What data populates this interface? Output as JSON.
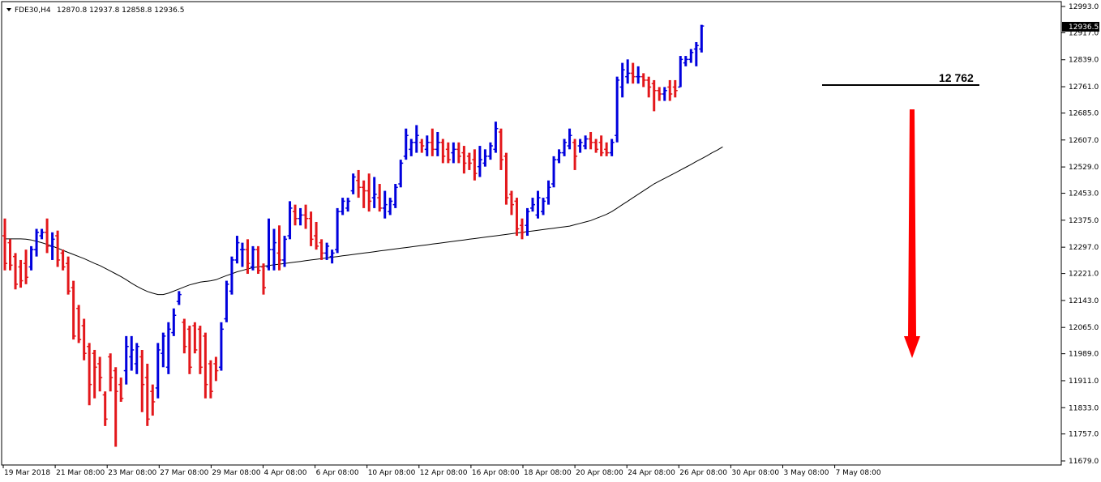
{
  "header": {
    "symbol": "FDE30,H4",
    "ohlc": "12870.8 12937.8 12858.8 12936.5"
  },
  "current_price_label": "12936.5",
  "level_label": "12 762",
  "colors": {
    "up": "#0000dd",
    "down": "#e3171b",
    "ma": "#000000",
    "arrow": "#ff0000",
    "price_box": "#000000"
  },
  "chart_data": {
    "type": "ohlc",
    "y_ticks": [
      "12993.0",
      "12917.0",
      "12839.0",
      "12761.0",
      "12685.0",
      "12607.0",
      "12529.0",
      "12453.0",
      "12375.0",
      "12297.0",
      "12221.0",
      "12143.0",
      "12065.0",
      "11989.0",
      "11911.0",
      "11833.0",
      "11757.0",
      "11679.0"
    ],
    "ylim": [
      11679,
      12993
    ],
    "x_ticks": [
      "19 Mar 2018",
      "21 Mar 08:00",
      "23 Mar 08:00",
      "27 Mar 08:00",
      "29 Mar 08:00",
      "4 Apr 08:00",
      "6 Apr 08:00",
      "10 Apr 08:00",
      "12 Apr 08:00",
      "16 Apr 08:00",
      "18 Apr 08:00",
      "20 Apr 08:00",
      "24 Apr 08:00",
      "26 Apr 08:00",
      "30 Apr 08:00",
      "3 May 08:00",
      "7 May 08:00"
    ],
    "bars": [
      {
        "o": 12330,
        "h": 12380,
        "l": 12230,
        "c": 12250
      },
      {
        "o": 12310,
        "h": 12320,
        "l": 12230,
        "c": 12245
      },
      {
        "o": 12270,
        "h": 12280,
        "l": 12175,
        "c": 12190
      },
      {
        "o": 12240,
        "h": 12260,
        "l": 12180,
        "c": 12200
      },
      {
        "o": 12250,
        "h": 12290,
        "l": 12190,
        "c": 12210
      },
      {
        "o": 12240,
        "h": 12300,
        "l": 12230,
        "c": 12290
      },
      {
        "o": 12290,
        "h": 12350,
        "l": 12270,
        "c": 12340
      },
      {
        "o": 12330,
        "h": 12350,
        "l": 12320,
        "c": 12340
      },
      {
        "o": 12340,
        "h": 12380,
        "l": 12280,
        "c": 12300
      },
      {
        "o": 12300,
        "h": 12340,
        "l": 12260,
        "c": 12320
      },
      {
        "o": 12330,
        "h": 12345,
        "l": 12240,
        "c": 12260
      },
      {
        "o": 12280,
        "h": 12290,
        "l": 12230,
        "c": 12240
      },
      {
        "o": 12250,
        "h": 12270,
        "l": 12160,
        "c": 12170
      },
      {
        "o": 12180,
        "h": 12200,
        "l": 12030,
        "c": 12040
      },
      {
        "o": 12120,
        "h": 12130,
        "l": 12020,
        "c": 12030
      },
      {
        "o": 12070,
        "h": 12090,
        "l": 11970,
        "c": 11990
      },
      {
        "o": 12010,
        "h": 12020,
        "l": 11840,
        "c": 11900
      },
      {
        "o": 11990,
        "h": 12000,
        "l": 11860,
        "c": 11950
      },
      {
        "o": 11960,
        "h": 11980,
        "l": 11880,
        "c": 11920
      },
      {
        "o": 11870,
        "h": 11880,
        "l": 11780,
        "c": 11800
      },
      {
        "o": 11980,
        "h": 11990,
        "l": 11880,
        "c": 11920
      },
      {
        "o": 11940,
        "h": 11950,
        "l": 11720,
        "c": 11880
      },
      {
        "o": 11900,
        "h": 11920,
        "l": 11850,
        "c": 11860
      },
      {
        "o": 11940,
        "h": 12040,
        "l": 11900,
        "c": 12010
      },
      {
        "o": 11980,
        "h": 12040,
        "l": 11940,
        "c": 12000
      },
      {
        "o": 11960,
        "h": 12020,
        "l": 11930,
        "c": 12010
      },
      {
        "o": 11980,
        "h": 12000,
        "l": 11820,
        "c": 11900
      },
      {
        "o": 11920,
        "h": 11960,
        "l": 11780,
        "c": 11800
      },
      {
        "o": 11880,
        "h": 11900,
        "l": 11810,
        "c": 11850
      },
      {
        "o": 11890,
        "h": 12020,
        "l": 11860,
        "c": 12000
      },
      {
        "o": 11990,
        "h": 12050,
        "l": 11950,
        "c": 12040
      },
      {
        "o": 11950,
        "h": 12080,
        "l": 11930,
        "c": 12060
      },
      {
        "o": 12050,
        "h": 12120,
        "l": 12040,
        "c": 12100
      },
      {
        "o": 12140,
        "h": 12170,
        "l": 12130,
        "c": 12160
      },
      {
        "o": 12080,
        "h": 12090,
        "l": 11990,
        "c": 12010
      },
      {
        "o": 12060,
        "h": 12070,
        "l": 11930,
        "c": 11950
      },
      {
        "o": 12070,
        "h": 12080,
        "l": 11990,
        "c": 12000
      },
      {
        "o": 12060,
        "h": 12070,
        "l": 11930,
        "c": 11950
      },
      {
        "o": 12040,
        "h": 12050,
        "l": 11860,
        "c": 11900
      },
      {
        "o": 11960,
        "h": 11970,
        "l": 11860,
        "c": 11880
      },
      {
        "o": 11960,
        "h": 11980,
        "l": 11910,
        "c": 11940
      },
      {
        "o": 11950,
        "h": 12080,
        "l": 11940,
        "c": 12060
      },
      {
        "o": 12090,
        "h": 12200,
        "l": 12080,
        "c": 12190
      },
      {
        "o": 12170,
        "h": 12270,
        "l": 12160,
        "c": 12260
      },
      {
        "o": 12260,
        "h": 12330,
        "l": 12250,
        "c": 12310
      },
      {
        "o": 12290,
        "h": 12310,
        "l": 12240,
        "c": 12290
      },
      {
        "o": 12290,
        "h": 12320,
        "l": 12220,
        "c": 12250
      },
      {
        "o": 12240,
        "h": 12300,
        "l": 12230,
        "c": 12290
      },
      {
        "o": 12290,
        "h": 12300,
        "l": 12220,
        "c": 12230
      },
      {
        "o": 12240,
        "h": 12250,
        "l": 12160,
        "c": 12180
      },
      {
        "o": 12240,
        "h": 12380,
        "l": 12230,
        "c": 12290
      },
      {
        "o": 12290,
        "h": 12350,
        "l": 12230,
        "c": 12310
      },
      {
        "o": 12280,
        "h": 12360,
        "l": 12230,
        "c": 12260
      },
      {
        "o": 12260,
        "h": 12330,
        "l": 12240,
        "c": 12320
      },
      {
        "o": 12330,
        "h": 12430,
        "l": 12320,
        "c": 12410
      },
      {
        "o": 12400,
        "h": 12420,
        "l": 12360,
        "c": 12380
      },
      {
        "o": 12380,
        "h": 12410,
        "l": 12360,
        "c": 12390
      },
      {
        "o": 12390,
        "h": 12420,
        "l": 12350,
        "c": 12380
      },
      {
        "o": 12380,
        "h": 12400,
        "l": 12300,
        "c": 12320
      },
      {
        "o": 12330,
        "h": 12370,
        "l": 12290,
        "c": 12300
      },
      {
        "o": 12310,
        "h": 12320,
        "l": 12260,
        "c": 12280
      },
      {
        "o": 12280,
        "h": 12310,
        "l": 12260,
        "c": 12300
      },
      {
        "o": 12270,
        "h": 12290,
        "l": 12250,
        "c": 12280
      },
      {
        "o": 12290,
        "h": 12410,
        "l": 12280,
        "c": 12400
      },
      {
        "o": 12400,
        "h": 12440,
        "l": 12390,
        "c": 12430
      },
      {
        "o": 12410,
        "h": 12440,
        "l": 12400,
        "c": 12430
      },
      {
        "o": 12460,
        "h": 12510,
        "l": 12450,
        "c": 12500
      },
      {
        "o": 12490,
        "h": 12520,
        "l": 12440,
        "c": 12470
      },
      {
        "o": 12470,
        "h": 12490,
        "l": 12410,
        "c": 12460
      },
      {
        "o": 12460,
        "h": 12510,
        "l": 12400,
        "c": 12430
      },
      {
        "o": 12440,
        "h": 12500,
        "l": 12410,
        "c": 12450
      },
      {
        "o": 12440,
        "h": 12480,
        "l": 12400,
        "c": 12410
      },
      {
        "o": 12410,
        "h": 12460,
        "l": 12380,
        "c": 12420
      },
      {
        "o": 12400,
        "h": 12440,
        "l": 12390,
        "c": 12430
      },
      {
        "o": 12420,
        "h": 12480,
        "l": 12410,
        "c": 12470
      },
      {
        "o": 12480,
        "h": 12550,
        "l": 12470,
        "c": 12540
      },
      {
        "o": 12560,
        "h": 12640,
        "l": 12550,
        "c": 12620
      },
      {
        "o": 12580,
        "h": 12610,
        "l": 12560,
        "c": 12600
      },
      {
        "o": 12600,
        "h": 12650,
        "l": 12570,
        "c": 12620
      },
      {
        "o": 12600,
        "h": 12610,
        "l": 12570,
        "c": 12590
      },
      {
        "o": 12580,
        "h": 12620,
        "l": 12560,
        "c": 12600
      },
      {
        "o": 12600,
        "h": 12640,
        "l": 12560,
        "c": 12580
      },
      {
        "o": 12580,
        "h": 12630,
        "l": 12560,
        "c": 12600
      },
      {
        "o": 12600,
        "h": 12610,
        "l": 12540,
        "c": 12560
      },
      {
        "o": 12580,
        "h": 12600,
        "l": 12540,
        "c": 12550
      },
      {
        "o": 12570,
        "h": 12600,
        "l": 12540,
        "c": 12580
      },
      {
        "o": 12580,
        "h": 12600,
        "l": 12540,
        "c": 12560
      },
      {
        "o": 12570,
        "h": 12590,
        "l": 12510,
        "c": 12540
      },
      {
        "o": 12560,
        "h": 12570,
        "l": 12520,
        "c": 12540
      },
      {
        "o": 12550,
        "h": 12580,
        "l": 12490,
        "c": 12510
      },
      {
        "o": 12530,
        "h": 12590,
        "l": 12500,
        "c": 12550
      },
      {
        "o": 12540,
        "h": 12580,
        "l": 12530,
        "c": 12560
      },
      {
        "o": 12560,
        "h": 12600,
        "l": 12550,
        "c": 12590
      },
      {
        "o": 12580,
        "h": 12660,
        "l": 12570,
        "c": 12640
      },
      {
        "o": 12630,
        "h": 12640,
        "l": 12520,
        "c": 12550
      },
      {
        "o": 12560,
        "h": 12570,
        "l": 12420,
        "c": 12440
      },
      {
        "o": 12450,
        "h": 12460,
        "l": 12390,
        "c": 12420
      },
      {
        "o": 12430,
        "h": 12440,
        "l": 12330,
        "c": 12350
      },
      {
        "o": 12360,
        "h": 12380,
        "l": 12320,
        "c": 12340
      },
      {
        "o": 12360,
        "h": 12410,
        "l": 12330,
        "c": 12400
      },
      {
        "o": 12410,
        "h": 12440,
        "l": 12400,
        "c": 12420
      },
      {
        "o": 12390,
        "h": 12460,
        "l": 12380,
        "c": 12440
      },
      {
        "o": 12400,
        "h": 12440,
        "l": 12390,
        "c": 12430
      },
      {
        "o": 12440,
        "h": 12490,
        "l": 12420,
        "c": 12470
      },
      {
        "o": 12480,
        "h": 12560,
        "l": 12470,
        "c": 12550
      },
      {
        "o": 12550,
        "h": 12580,
        "l": 12540,
        "c": 12570
      },
      {
        "o": 12570,
        "h": 12610,
        "l": 12560,
        "c": 12600
      },
      {
        "o": 12590,
        "h": 12640,
        "l": 12580,
        "c": 12620
      },
      {
        "o": 12600,
        "h": 12610,
        "l": 12520,
        "c": 12560
      },
      {
        "o": 12590,
        "h": 12610,
        "l": 12570,
        "c": 12600
      },
      {
        "o": 12590,
        "h": 12620,
        "l": 12580,
        "c": 12610
      },
      {
        "o": 12610,
        "h": 12630,
        "l": 12580,
        "c": 12600
      },
      {
        "o": 12600,
        "h": 12610,
        "l": 12570,
        "c": 12580
      },
      {
        "o": 12600,
        "h": 12620,
        "l": 12560,
        "c": 12570
      },
      {
        "o": 12580,
        "h": 12600,
        "l": 12560,
        "c": 12570
      },
      {
        "o": 12570,
        "h": 12610,
        "l": 12560,
        "c": 12600
      },
      {
        "o": 12620,
        "h": 12790,
        "l": 12600,
        "c": 12780
      },
      {
        "o": 12760,
        "h": 12830,
        "l": 12730,
        "c": 12810
      },
      {
        "o": 12790,
        "h": 12840,
        "l": 12770,
        "c": 12800
      },
      {
        "o": 12800,
        "h": 12830,
        "l": 12770,
        "c": 12790
      },
      {
        "o": 12790,
        "h": 12820,
        "l": 12770,
        "c": 12790
      },
      {
        "o": 12790,
        "h": 12800,
        "l": 12760,
        "c": 12780
      },
      {
        "o": 12780,
        "h": 12790,
        "l": 12730,
        "c": 12760
      },
      {
        "o": 12770,
        "h": 12780,
        "l": 12690,
        "c": 12750
      },
      {
        "o": 12750,
        "h": 12760,
        "l": 12720,
        "c": 12740
      },
      {
        "o": 12740,
        "h": 12760,
        "l": 12720,
        "c": 12750
      },
      {
        "o": 12760,
        "h": 12780,
        "l": 12720,
        "c": 12740
      },
      {
        "o": 12760,
        "h": 12780,
        "l": 12730,
        "c": 12750
      },
      {
        "o": 12760,
        "h": 12850,
        "l": 12760,
        "c": 12840
      },
      {
        "o": 12830,
        "h": 12850,
        "l": 12820,
        "c": 12840
      },
      {
        "o": 12840,
        "h": 12870,
        "l": 12830,
        "c": 12860
      },
      {
        "o": 12870,
        "h": 12890,
        "l": 12820,
        "c": 12880
      },
      {
        "o": 12870,
        "h": 12940,
        "l": 12860,
        "c": 12936.5
      }
    ],
    "ma": [
      12321,
      12321,
      12321,
      12321,
      12320,
      12318,
      12314,
      12310,
      12305,
      12300,
      12294,
      12288,
      12282,
      12276,
      12270,
      12264,
      12257,
      12250,
      12244,
      12236,
      12228,
      12220,
      12212,
      12203,
      12193,
      12184,
      12176,
      12169,
      12164,
      12160,
      12160,
      12164,
      12170,
      12176,
      12182,
      12188,
      12192,
      12196,
      12198,
      12200,
      12203,
      12209,
      12215,
      12220,
      12226,
      12230,
      12234,
      12238,
      12240,
      12242,
      12244,
      12246,
      12248,
      12250,
      12252,
      12254,
      12256,
      12258,
      12260,
      12262,
      12264,
      12266,
      12268,
      12270,
      12272,
      12274,
      12276,
      12278,
      12280,
      12282,
      12284,
      12286,
      12288,
      12290,
      12292,
      12294,
      12296,
      12298,
      12300,
      12302,
      12304,
      12306,
      12308,
      12310,
      12312,
      12314,
      12316,
      12318,
      12320,
      12322,
      12324,
      12326,
      12328,
      12330,
      12332,
      12334,
      12336,
      12338,
      12340,
      12342,
      12344,
      12346,
      12348,
      12350,
      12352,
      12354,
      12356,
      12358,
      12362,
      12366,
      12370,
      12374,
      12380,
      12386,
      12392,
      12400,
      12410,
      12420,
      12430,
      12440,
      12450,
      12460,
      12470,
      12480,
      12488,
      12496,
      12504,
      12512,
      12520,
      12528,
      12536,
      12545,
      12553,
      12561,
      12570,
      12578,
      12587
    ]
  }
}
